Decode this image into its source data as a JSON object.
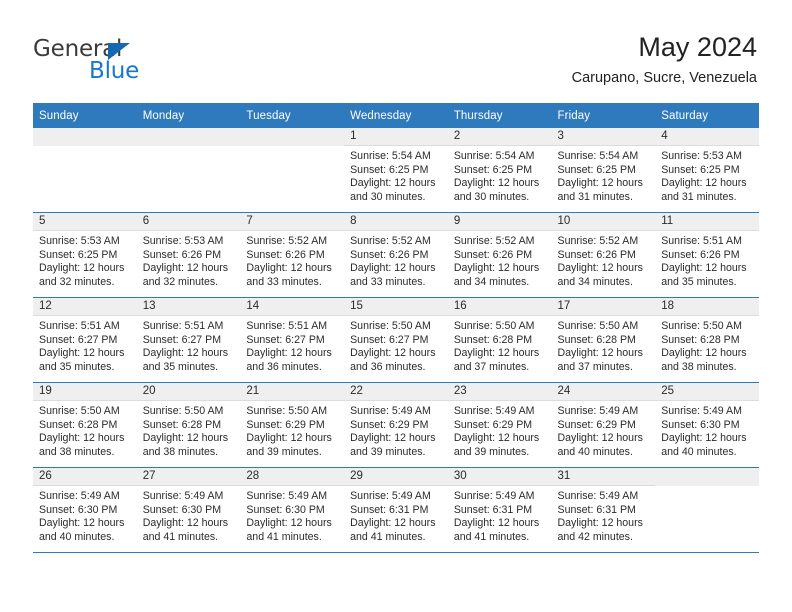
{
  "brand": {
    "name_top": "General",
    "name_bottom": "Blue",
    "accent_color": "#1877c9",
    "triangle_color": "#1668b3"
  },
  "header": {
    "title": "May 2024",
    "subtitle": "Carupano, Sucre, Venezuela"
  },
  "theme": {
    "header_band": "#2f79bd",
    "daynum_band": "#efefef",
    "text": "#2b2b2b"
  },
  "weekdays": [
    "Sunday",
    "Monday",
    "Tuesday",
    "Wednesday",
    "Thursday",
    "Friday",
    "Saturday"
  ],
  "weeks": [
    [
      {
        "day": "",
        "empty": true,
        "sunrise": "",
        "sunset": "",
        "daylight_line1": "",
        "daylight_line2": ""
      },
      {
        "day": "",
        "empty": true,
        "sunrise": "",
        "sunset": "",
        "daylight_line1": "",
        "daylight_line2": ""
      },
      {
        "day": "",
        "empty": true,
        "sunrise": "",
        "sunset": "",
        "daylight_line1": "",
        "daylight_line2": ""
      },
      {
        "day": "1",
        "empty": false,
        "sunrise": "Sunrise: 5:54 AM",
        "sunset": "Sunset: 6:25 PM",
        "daylight_line1": "Daylight: 12 hours",
        "daylight_line2": "and 30 minutes."
      },
      {
        "day": "2",
        "empty": false,
        "sunrise": "Sunrise: 5:54 AM",
        "sunset": "Sunset: 6:25 PM",
        "daylight_line1": "Daylight: 12 hours",
        "daylight_line2": "and 30 minutes."
      },
      {
        "day": "3",
        "empty": false,
        "sunrise": "Sunrise: 5:54 AM",
        "sunset": "Sunset: 6:25 PM",
        "daylight_line1": "Daylight: 12 hours",
        "daylight_line2": "and 31 minutes."
      },
      {
        "day": "4",
        "empty": false,
        "sunrise": "Sunrise: 5:53 AM",
        "sunset": "Sunset: 6:25 PM",
        "daylight_line1": "Daylight: 12 hours",
        "daylight_line2": "and 31 minutes."
      }
    ],
    [
      {
        "day": "5",
        "empty": false,
        "sunrise": "Sunrise: 5:53 AM",
        "sunset": "Sunset: 6:25 PM",
        "daylight_line1": "Daylight: 12 hours",
        "daylight_line2": "and 32 minutes."
      },
      {
        "day": "6",
        "empty": false,
        "sunrise": "Sunrise: 5:53 AM",
        "sunset": "Sunset: 6:26 PM",
        "daylight_line1": "Daylight: 12 hours",
        "daylight_line2": "and 32 minutes."
      },
      {
        "day": "7",
        "empty": false,
        "sunrise": "Sunrise: 5:52 AM",
        "sunset": "Sunset: 6:26 PM",
        "daylight_line1": "Daylight: 12 hours",
        "daylight_line2": "and 33 minutes."
      },
      {
        "day": "8",
        "empty": false,
        "sunrise": "Sunrise: 5:52 AM",
        "sunset": "Sunset: 6:26 PM",
        "daylight_line1": "Daylight: 12 hours",
        "daylight_line2": "and 33 minutes."
      },
      {
        "day": "9",
        "empty": false,
        "sunrise": "Sunrise: 5:52 AM",
        "sunset": "Sunset: 6:26 PM",
        "daylight_line1": "Daylight: 12 hours",
        "daylight_line2": "and 34 minutes."
      },
      {
        "day": "10",
        "empty": false,
        "sunrise": "Sunrise: 5:52 AM",
        "sunset": "Sunset: 6:26 PM",
        "daylight_line1": "Daylight: 12 hours",
        "daylight_line2": "and 34 minutes."
      },
      {
        "day": "11",
        "empty": false,
        "sunrise": "Sunrise: 5:51 AM",
        "sunset": "Sunset: 6:26 PM",
        "daylight_line1": "Daylight: 12 hours",
        "daylight_line2": "and 35 minutes."
      }
    ],
    [
      {
        "day": "12",
        "empty": false,
        "sunrise": "Sunrise: 5:51 AM",
        "sunset": "Sunset: 6:27 PM",
        "daylight_line1": "Daylight: 12 hours",
        "daylight_line2": "and 35 minutes."
      },
      {
        "day": "13",
        "empty": false,
        "sunrise": "Sunrise: 5:51 AM",
        "sunset": "Sunset: 6:27 PM",
        "daylight_line1": "Daylight: 12 hours",
        "daylight_line2": "and 35 minutes."
      },
      {
        "day": "14",
        "empty": false,
        "sunrise": "Sunrise: 5:51 AM",
        "sunset": "Sunset: 6:27 PM",
        "daylight_line1": "Daylight: 12 hours",
        "daylight_line2": "and 36 minutes."
      },
      {
        "day": "15",
        "empty": false,
        "sunrise": "Sunrise: 5:50 AM",
        "sunset": "Sunset: 6:27 PM",
        "daylight_line1": "Daylight: 12 hours",
        "daylight_line2": "and 36 minutes."
      },
      {
        "day": "16",
        "empty": false,
        "sunrise": "Sunrise: 5:50 AM",
        "sunset": "Sunset: 6:28 PM",
        "daylight_line1": "Daylight: 12 hours",
        "daylight_line2": "and 37 minutes."
      },
      {
        "day": "17",
        "empty": false,
        "sunrise": "Sunrise: 5:50 AM",
        "sunset": "Sunset: 6:28 PM",
        "daylight_line1": "Daylight: 12 hours",
        "daylight_line2": "and 37 minutes."
      },
      {
        "day": "18",
        "empty": false,
        "sunrise": "Sunrise: 5:50 AM",
        "sunset": "Sunset: 6:28 PM",
        "daylight_line1": "Daylight: 12 hours",
        "daylight_line2": "and 38 minutes."
      }
    ],
    [
      {
        "day": "19",
        "empty": false,
        "sunrise": "Sunrise: 5:50 AM",
        "sunset": "Sunset: 6:28 PM",
        "daylight_line1": "Daylight: 12 hours",
        "daylight_line2": "and 38 minutes."
      },
      {
        "day": "20",
        "empty": false,
        "sunrise": "Sunrise: 5:50 AM",
        "sunset": "Sunset: 6:28 PM",
        "daylight_line1": "Daylight: 12 hours",
        "daylight_line2": "and 38 minutes."
      },
      {
        "day": "21",
        "empty": false,
        "sunrise": "Sunrise: 5:50 AM",
        "sunset": "Sunset: 6:29 PM",
        "daylight_line1": "Daylight: 12 hours",
        "daylight_line2": "and 39 minutes."
      },
      {
        "day": "22",
        "empty": false,
        "sunrise": "Sunrise: 5:49 AM",
        "sunset": "Sunset: 6:29 PM",
        "daylight_line1": "Daylight: 12 hours",
        "daylight_line2": "and 39 minutes."
      },
      {
        "day": "23",
        "empty": false,
        "sunrise": "Sunrise: 5:49 AM",
        "sunset": "Sunset: 6:29 PM",
        "daylight_line1": "Daylight: 12 hours",
        "daylight_line2": "and 39 minutes."
      },
      {
        "day": "24",
        "empty": false,
        "sunrise": "Sunrise: 5:49 AM",
        "sunset": "Sunset: 6:29 PM",
        "daylight_line1": "Daylight: 12 hours",
        "daylight_line2": "and 40 minutes."
      },
      {
        "day": "25",
        "empty": false,
        "sunrise": "Sunrise: 5:49 AM",
        "sunset": "Sunset: 6:30 PM",
        "daylight_line1": "Daylight: 12 hours",
        "daylight_line2": "and 40 minutes."
      }
    ],
    [
      {
        "day": "26",
        "empty": false,
        "sunrise": "Sunrise: 5:49 AM",
        "sunset": "Sunset: 6:30 PM",
        "daylight_line1": "Daylight: 12 hours",
        "daylight_line2": "and 40 minutes."
      },
      {
        "day": "27",
        "empty": false,
        "sunrise": "Sunrise: 5:49 AM",
        "sunset": "Sunset: 6:30 PM",
        "daylight_line1": "Daylight: 12 hours",
        "daylight_line2": "and 41 minutes."
      },
      {
        "day": "28",
        "empty": false,
        "sunrise": "Sunrise: 5:49 AM",
        "sunset": "Sunset: 6:30 PM",
        "daylight_line1": "Daylight: 12 hours",
        "daylight_line2": "and 41 minutes."
      },
      {
        "day": "29",
        "empty": false,
        "sunrise": "Sunrise: 5:49 AM",
        "sunset": "Sunset: 6:31 PM",
        "daylight_line1": "Daylight: 12 hours",
        "daylight_line2": "and 41 minutes."
      },
      {
        "day": "30",
        "empty": false,
        "sunrise": "Sunrise: 5:49 AM",
        "sunset": "Sunset: 6:31 PM",
        "daylight_line1": "Daylight: 12 hours",
        "daylight_line2": "and 41 minutes."
      },
      {
        "day": "31",
        "empty": false,
        "sunrise": "Sunrise: 5:49 AM",
        "sunset": "Sunset: 6:31 PM",
        "daylight_line1": "Daylight: 12 hours",
        "daylight_line2": "and 42 minutes."
      },
      {
        "day": "",
        "empty": true,
        "sunrise": "",
        "sunset": "",
        "daylight_line1": "",
        "daylight_line2": ""
      }
    ]
  ]
}
